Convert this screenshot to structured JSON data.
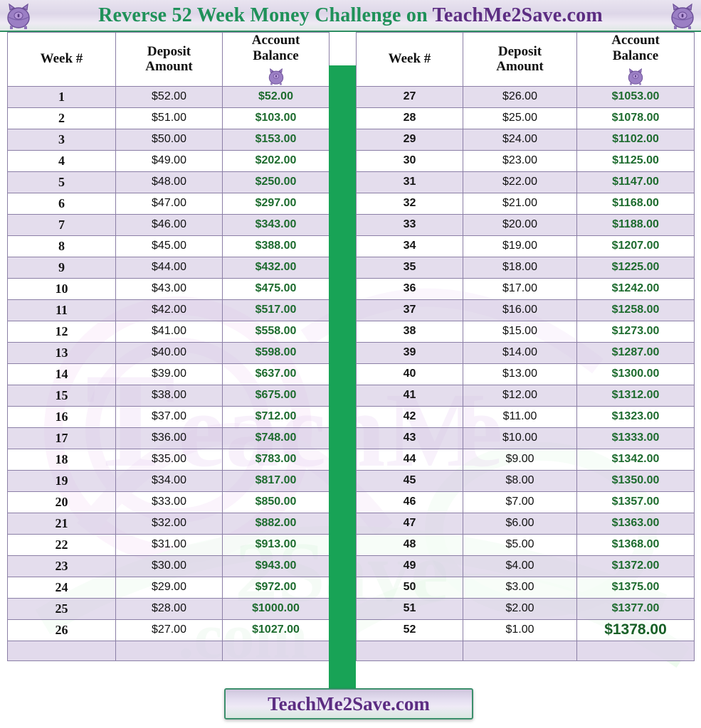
{
  "title": {
    "green_part": "Reverse 52 Week Money Challenge on ",
    "purple_part": "TeachMe2Save.com",
    "left_icon": "piggy-bank-icon",
    "right_icon": "piggy-bank-icon"
  },
  "columns": {
    "week": "Week #",
    "deposit_line1": "Deposit",
    "deposit_line2": "Amount",
    "balance_line1": "Account",
    "balance_line2": "Balance",
    "balance_icon": "piggy-bank-icon"
  },
  "colors": {
    "title_green": "#1f9159",
    "title_purple": "#5c2d82",
    "divider_green": "#18a356",
    "row_purple": "#ded5e9",
    "balance_green": "#1d6b2e",
    "border": "#8b7fa6"
  },
  "left_rows": [
    {
      "week": "1",
      "deposit": "$52.00",
      "balance": "$52.00"
    },
    {
      "week": "2",
      "deposit": "$51.00",
      "balance": "$103.00"
    },
    {
      "week": "3",
      "deposit": "$50.00",
      "balance": "$153.00"
    },
    {
      "week": "4",
      "deposit": "$49.00",
      "balance": "$202.00"
    },
    {
      "week": "5",
      "deposit": "$48.00",
      "balance": "$250.00"
    },
    {
      "week": "6",
      "deposit": "$47.00",
      "balance": "$297.00"
    },
    {
      "week": "7",
      "deposit": "$46.00",
      "balance": "$343.00"
    },
    {
      "week": "8",
      "deposit": "$45.00",
      "balance": "$388.00"
    },
    {
      "week": "9",
      "deposit": "$44.00",
      "balance": "$432.00"
    },
    {
      "week": "10",
      "deposit": "$43.00",
      "balance": "$475.00"
    },
    {
      "week": "11",
      "deposit": "$42.00",
      "balance": "$517.00"
    },
    {
      "week": "12",
      "deposit": "$41.00",
      "balance": "$558.00"
    },
    {
      "week": "13",
      "deposit": "$40.00",
      "balance": "$598.00"
    },
    {
      "week": "14",
      "deposit": "$39.00",
      "balance": "$637.00"
    },
    {
      "week": "15",
      "deposit": "$38.00",
      "balance": "$675.00"
    },
    {
      "week": "16",
      "deposit": "$37.00",
      "balance": "$712.00"
    },
    {
      "week": "17",
      "deposit": "$36.00",
      "balance": "$748.00"
    },
    {
      "week": "18",
      "deposit": "$35.00",
      "balance": "$783.00"
    },
    {
      "week": "19",
      "deposit": "$34.00",
      "balance": "$817.00"
    },
    {
      "week": "20",
      "deposit": "$33.00",
      "balance": "$850.00"
    },
    {
      "week": "21",
      "deposit": "$32.00",
      "balance": "$882.00"
    },
    {
      "week": "22",
      "deposit": "$31.00",
      "balance": "$913.00"
    },
    {
      "week": "23",
      "deposit": "$30.00",
      "balance": "$943.00"
    },
    {
      "week": "24",
      "deposit": "$29.00",
      "balance": "$972.00"
    },
    {
      "week": "25",
      "deposit": "$28.00",
      "balance": "$1000.00"
    },
    {
      "week": "26",
      "deposit": "$27.00",
      "balance": "$1027.00"
    }
  ],
  "right_rows": [
    {
      "week": "27",
      "deposit": "$26.00",
      "balance": "$1053.00"
    },
    {
      "week": "28",
      "deposit": "$25.00",
      "balance": "$1078.00"
    },
    {
      "week": "29",
      "deposit": "$24.00",
      "balance": "$1102.00"
    },
    {
      "week": "30",
      "deposit": "$23.00",
      "balance": "$1125.00"
    },
    {
      "week": "31",
      "deposit": "$22.00",
      "balance": "$1147.00"
    },
    {
      "week": "32",
      "deposit": "$21.00",
      "balance": "$1168.00"
    },
    {
      "week": "33",
      "deposit": "$20.00",
      "balance": "$1188.00"
    },
    {
      "week": "34",
      "deposit": "$19.00",
      "balance": "$1207.00"
    },
    {
      "week": "35",
      "deposit": "$18.00",
      "balance": "$1225.00"
    },
    {
      "week": "36",
      "deposit": "$17.00",
      "balance": "$1242.00"
    },
    {
      "week": "37",
      "deposit": "$16.00",
      "balance": "$1258.00"
    },
    {
      "week": "38",
      "deposit": "$15.00",
      "balance": "$1273.00"
    },
    {
      "week": "39",
      "deposit": "$14.00",
      "balance": "$1287.00"
    },
    {
      "week": "40",
      "deposit": "$13.00",
      "balance": "$1300.00"
    },
    {
      "week": "41",
      "deposit": "$12.00",
      "balance": "$1312.00"
    },
    {
      "week": "42",
      "deposit": "$11.00",
      "balance": "$1323.00"
    },
    {
      "week": "43",
      "deposit": "$10.00",
      "balance": "$1333.00"
    },
    {
      "week": "44",
      "deposit": "$9.00",
      "balance": "$1342.00"
    },
    {
      "week": "45",
      "deposit": "$8.00",
      "balance": "$1350.00"
    },
    {
      "week": "46",
      "deposit": "$7.00",
      "balance": "$1357.00"
    },
    {
      "week": "47",
      "deposit": "$6.00",
      "balance": "$1363.00"
    },
    {
      "week": "48",
      "deposit": "$5.00",
      "balance": "$1368.00"
    },
    {
      "week": "49",
      "deposit": "$4.00",
      "balance": "$1372.00"
    },
    {
      "week": "50",
      "deposit": "$3.00",
      "balance": "$1375.00"
    },
    {
      "week": "51",
      "deposit": "$2.00",
      "balance": "$1377.00"
    },
    {
      "week": "52",
      "deposit": "$1.00",
      "balance": "$1378.00"
    }
  ],
  "footer": {
    "label": "TeachMe2Save.com"
  }
}
